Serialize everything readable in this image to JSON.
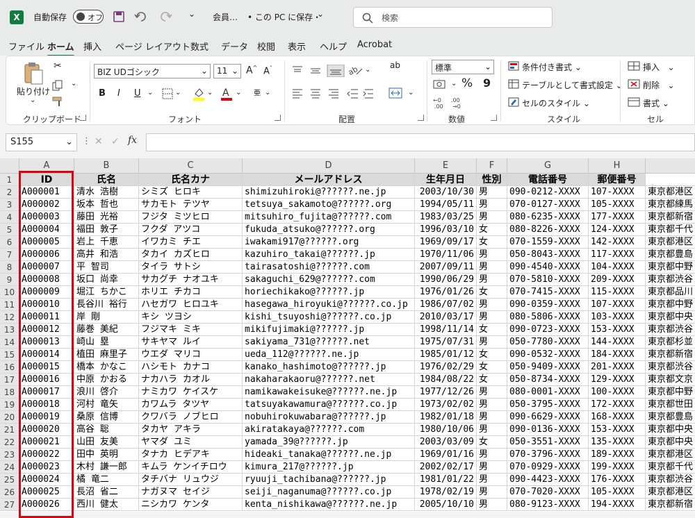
{
  "titlebar": {
    "autosave_label": "自動保存",
    "autosave_state": "オフ",
    "filename": "会員…",
    "save_location": "• この PC に保存・",
    "save_chevron": "⌄",
    "qat_more": "⌄",
    "search_placeholder": "検索"
  },
  "menus": [
    "ファイル",
    "ホーム",
    "挿入",
    "ページ レイアウト",
    "数式",
    "データ",
    "校閲",
    "表示",
    "ヘルプ",
    "Acrobat"
  ],
  "ribbon": {
    "clipboard": {
      "label": "クリップボード",
      "paste": "貼り付け"
    },
    "font": {
      "label": "フォント",
      "font_name": "BIZ UDゴシック",
      "font_size": "11",
      "grow": "A^",
      "shrink": "Aˇ",
      "bold": "B",
      "italic": "I",
      "underline": "U",
      "phonetic": "亜"
    },
    "alignment": {
      "label": "配置",
      "wrap": "ab"
    },
    "number": {
      "label": "数値",
      "format": "標準",
      "percent": "%",
      "comma": "9"
    },
    "styles": {
      "label": "スタイル",
      "conditional": "条件付き書式",
      "table": "テーブルとして書式設定",
      "cell_style": "セルのスタイル"
    },
    "cells": {
      "label": "セル",
      "insert": "挿入",
      "delete": "削除",
      "format": "書式"
    }
  },
  "formula": {
    "namebox": "S155",
    "fx": "fx",
    "value": ""
  },
  "columns": [
    "A",
    "B",
    "C",
    "D",
    "E",
    "F",
    "G",
    "H"
  ],
  "header_row": [
    "ID",
    "氏名",
    "氏名カナ",
    "メールアドレス",
    "生年月日",
    "性別",
    "電話番号",
    "郵便番号"
  ],
  "rows": [
    [
      "A000001",
      "清水 浩樹",
      "シミズ ヒロキ",
      "shimizuhiroki@??????.ne.jp",
      "2003/10/30",
      "男",
      "090-0212-XXXX",
      "107-XXXX",
      "東京都港区"
    ],
    [
      "A000002",
      "坂本 哲也",
      "サカモト テツヤ",
      "tetsuya_sakamoto@??????.org",
      "1994/05/11",
      "男",
      "070-0127-XXXX",
      "105-XXXX",
      "東京都練馬"
    ],
    [
      "A000003",
      "藤田 光裕",
      "フジタ ミツヒロ",
      "mitsuhiro_fujita@??????.com",
      "1983/03/25",
      "男",
      "080-6235-XXXX",
      "177-XXXX",
      "東京都新宿"
    ],
    [
      "A000004",
      "福田 敦子",
      "フクダ アツコ",
      "fukuda_atsuko@??????.org",
      "1996/03/10",
      "女",
      "080-8226-XXXX",
      "124-XXXX",
      "東京都千代"
    ],
    [
      "A000005",
      "岩上 千恵",
      "イワカミ チエ",
      "iwakami917@??????.org",
      "1969/09/17",
      "女",
      "070-1559-XXXX",
      "142-XXXX",
      "東京都港区"
    ],
    [
      "A000006",
      "高井 和浩",
      "タカイ カズヒロ",
      "kazuhiro_takai@??????.jp",
      "1970/11/06",
      "男",
      "050-8043-XXXX",
      "117-XXXX",
      "東京都豊島"
    ],
    [
      "A000007",
      "平 智司",
      "タイラ サトシ",
      "tairasatoshi@??????.com",
      "2007/09/11",
      "男",
      "090-4540-XXXX",
      "104-XXXX",
      "東京都中野"
    ],
    [
      "A000008",
      "坂口 尚幸",
      "サカグチ ナオユキ",
      "sakaguchi_629@??????.com",
      "1990/06/29",
      "男",
      "070-5810-XXXX",
      "209-XXXX",
      "東京都渋谷"
    ],
    [
      "A000009",
      "堀江 ちかこ",
      "ホリエ チカコ",
      "horiechikako@??????.jp",
      "1976/01/26",
      "女",
      "070-7415-XXXX",
      "115-XXXX",
      "東京都品川"
    ],
    [
      "A000010",
      "長谷川 裕行",
      "ハセガワ ヒロユキ",
      "hasegawa_hiroyuki@??????.co.jp",
      "1986/07/02",
      "男",
      "090-0359-XXXX",
      "107-XXXX",
      "東京都中野"
    ],
    [
      "A000011",
      "岸 剛",
      "キシ ツヨシ",
      "kishi_tsuyoshi@??????.co.jp",
      "2010/03/17",
      "男",
      "080-5806-XXXX",
      "103-XXXX",
      "東京都中央"
    ],
    [
      "A000012",
      "藤巻 美紀",
      "フジマキ ミキ",
      "mikifujimaki@??????.jp",
      "1998/11/14",
      "女",
      "090-0723-XXXX",
      "153-XXXX",
      "東京都渋谷"
    ],
    [
      "A000013",
      "崎山 塁",
      "サキヤマ ルイ",
      "sakiyama_731@??????.net",
      "1975/07/31",
      "男",
      "050-7780-XXXX",
      "144-XXXX",
      "東京都杉並"
    ],
    [
      "A000014",
      "植田 麻里子",
      "ウエダ マリコ",
      "ueda_112@??????.ne.jp",
      "1985/01/12",
      "女",
      "090-0532-XXXX",
      "184-XXXX",
      "東京都新宿"
    ],
    [
      "A000015",
      "橋本 かなこ",
      "ハシモト カナコ",
      "kanako_hashimoto@??????.jp",
      "1976/02/29",
      "女",
      "050-9409-XXXX",
      "201-XXXX",
      "東京都渋谷"
    ],
    [
      "A000016",
      "中原 かおる",
      "ナカハラ カオル",
      "nakaharakaoru@??????.net",
      "1984/08/22",
      "女",
      "050-8734-XXXX",
      "129-XXXX",
      "東京都文京"
    ],
    [
      "A000017",
      "浪川 啓介",
      "ナミカワ ケイスケ",
      "namikawakeisuke@??????.ne.jp",
      "1977/12/26",
      "男",
      "080-0001-XXXX",
      "100-XXXX",
      "東京都中野"
    ],
    [
      "A000018",
      "河村 竜矢",
      "カワムラ タツヤ",
      "tatsuyakawamura@??????.co.jp",
      "1973/02/02",
      "男",
      "050-3795-XXXX",
      "172-XXXX",
      "東京都世田"
    ],
    [
      "A000019",
      "桑原 信博",
      "クワバラ ノブヒロ",
      "nobuhirokuwabara@??????.jp",
      "1982/01/18",
      "男",
      "090-6629-XXXX",
      "168-XXXX",
      "東京都豊島"
    ],
    [
      "A000020",
      "高谷 聡",
      "タカヤ アキラ",
      "akiratakaya@??????.com",
      "1980/10/06",
      "男",
      "090-0136-XXXX",
      "153-XXXX",
      "東京都中央"
    ],
    [
      "A000021",
      "山田 友美",
      "ヤマダ ユミ",
      "yamada_39@??????.jp",
      "2003/03/09",
      "女",
      "050-3551-XXXX",
      "135-XXXX",
      "東京都中央"
    ],
    [
      "A000022",
      "田中 英明",
      "タナカ ヒデアキ",
      "hideaki_tanaka@??????.ne.jp",
      "1969/01/16",
      "男",
      "070-3796-XXXX",
      "189-XXXX",
      "東京都港区"
    ],
    [
      "A000023",
      "木村 謙一郎",
      "キムラ ケンイチロウ",
      "kimura_217@??????.jp",
      "2002/02/17",
      "男",
      "070-0929-XXXX",
      "199-XXXX",
      "東京都千代"
    ],
    [
      "A000024",
      "橘 竜二",
      "タチバナ リュウジ",
      "ryuuji_tachibana@??????.jp",
      "1981/01/22",
      "男",
      "090-4423-XXXX",
      "176-XXXX",
      "東京都渋谷"
    ],
    [
      "A000025",
      "長沼 省二",
      "ナガヌマ セイジ",
      "seiji_naganuma@??????.co.jp",
      "1978/02/19",
      "男",
      "070-7020-XXXX",
      "105-XXXX",
      "東京都港区"
    ],
    [
      "A000026",
      "西川 健太",
      "ニシカワ ケンタ",
      "kenta_nishikawa@??????.ne.jp",
      "2005/10/10",
      "男",
      "080-9123-XXXX",
      "194-XXXX",
      "東京都新宿"
    ]
  ],
  "colors": {
    "excel_green": "#107c41",
    "highlight_red": "#e3000f"
  }
}
